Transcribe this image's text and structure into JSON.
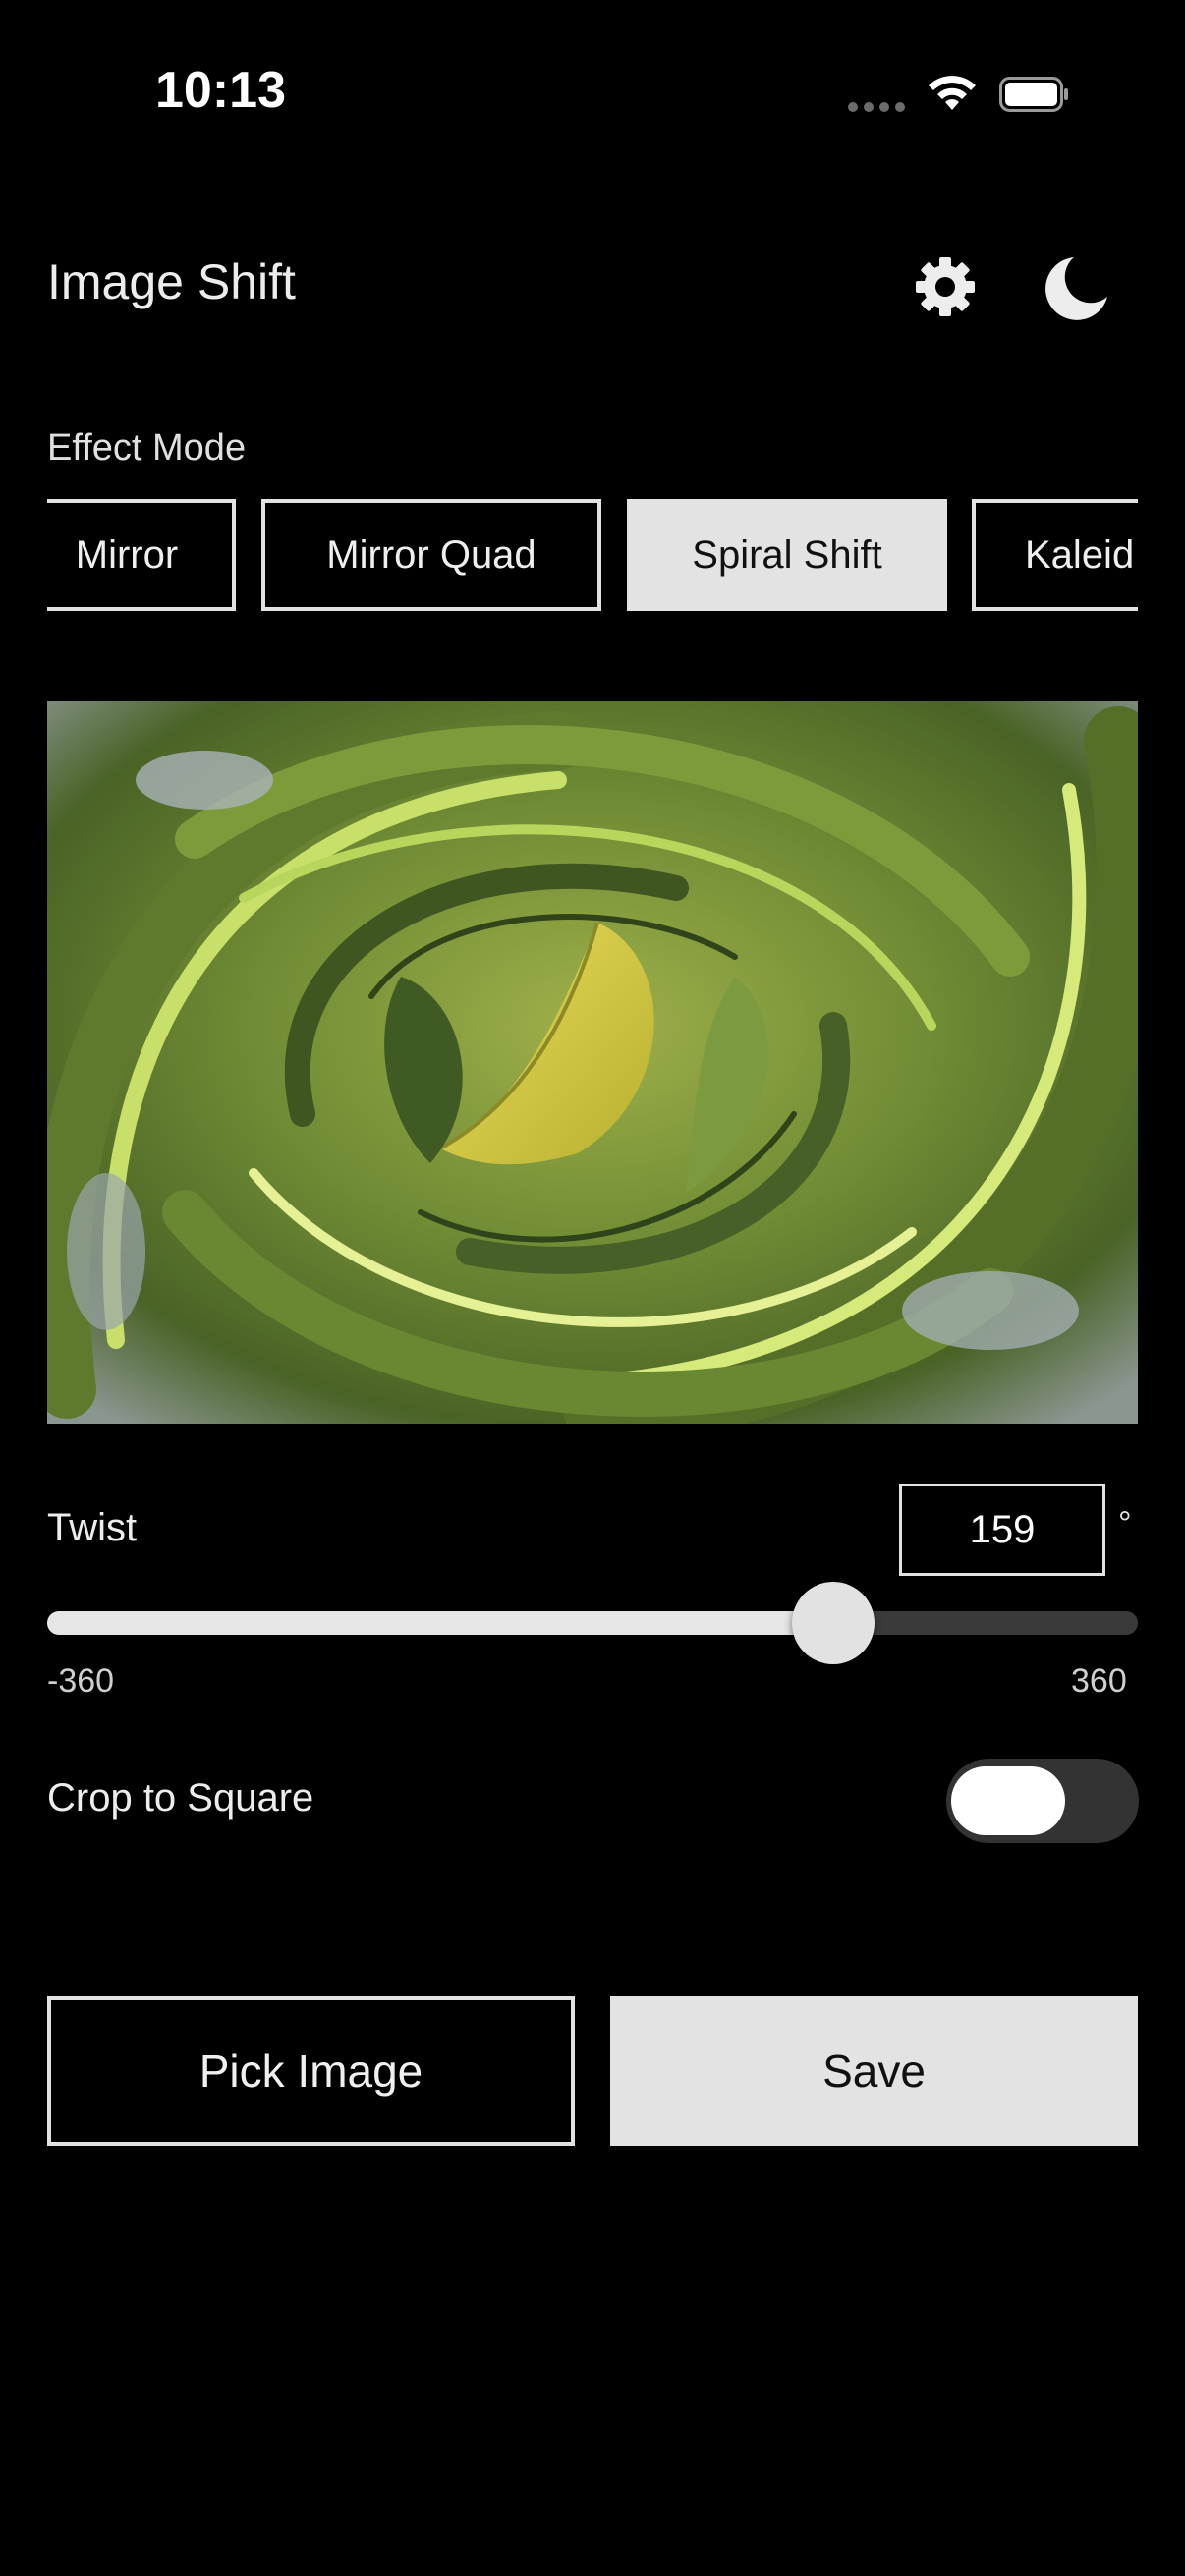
{
  "status_bar": {
    "time": "10:13"
  },
  "header": {
    "title": "Image Shift",
    "settings_icon": "gear-icon",
    "theme_icon": "moon-icon"
  },
  "effect_mode": {
    "label": "Effect Mode",
    "options": [
      "Mirror",
      "Mirror Quad",
      "Spiral Shift",
      "Kaleid"
    ],
    "selected": "Spiral Shift"
  },
  "preview": {
    "description_icon": "image-preview"
  },
  "twist": {
    "label": "Twist",
    "value": "159",
    "unit": "°",
    "min": "-360",
    "max": "360",
    "value_numeric": 159,
    "min_numeric": -360,
    "max_numeric": 360
  },
  "crop": {
    "label": "Crop to Square",
    "enabled": false
  },
  "actions": {
    "pick_label": "Pick Image",
    "save_label": "Save"
  },
  "colors": {
    "background": "#000000",
    "selected_chip": "#e3e3e3",
    "accent_light": "#e2e2e2"
  }
}
